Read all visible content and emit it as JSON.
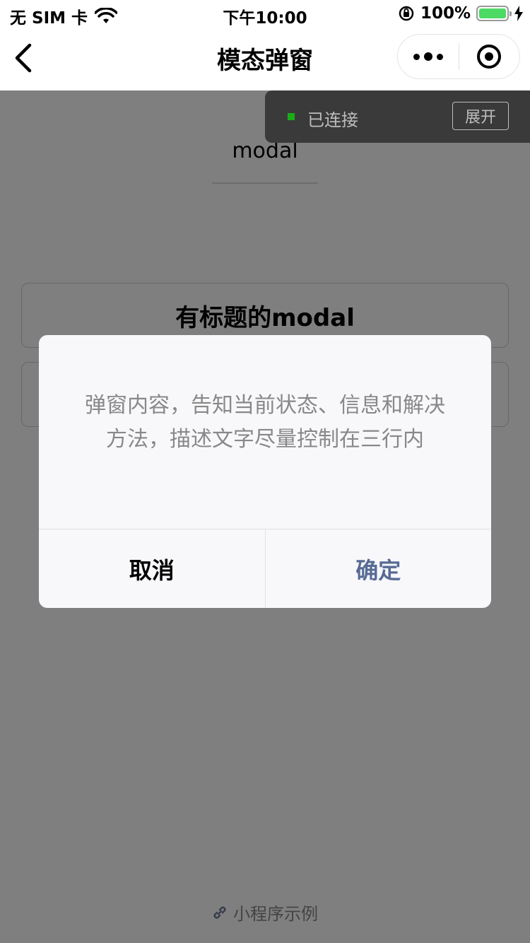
{
  "status_bar": {
    "carrier": "无 SIM 卡",
    "time": "下午10:00",
    "battery": "100%",
    "battery_color": "#4cd964"
  },
  "nav": {
    "title": "模态弹窗",
    "back_icon": "chevron-left-icon",
    "more_icon": "more-dots-icon",
    "close_icon": "target-close-icon"
  },
  "page": {
    "heading": "modal",
    "buttons": [
      {
        "label": "有标题的modal"
      },
      {
        "label": ""
      }
    ],
    "footer": "小程序示例",
    "footer_icon": "link-icon"
  },
  "debug_panel": {
    "status": "已连接",
    "status_color": "#1aad19",
    "expand_label": "展开"
  },
  "modal": {
    "content": "弹窗内容，告知当前状态、信息和解决方法，描述文字尽量控制在三行内",
    "cancel_label": "取消",
    "confirm_label": "确定",
    "confirm_color": "#576b95"
  }
}
